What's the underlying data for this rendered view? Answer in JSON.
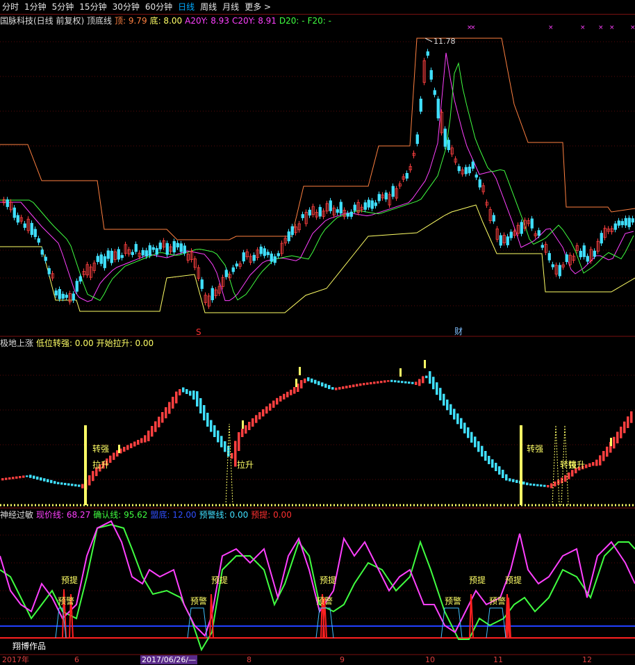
{
  "toolbar": {
    "items": [
      "分时",
      "1分钟",
      "5分钟",
      "15分钟",
      "30分钟",
      "60分钟",
      "日线",
      "周线",
      "月线",
      "更多 >"
    ],
    "active": "日线"
  },
  "panel1": {
    "title": "国脉科技(日线 前复权) 顶底线",
    "ding_label": "顶: 9.79",
    "di_label": "底: 8.00",
    "a20y_label": "A20Y: 8.93",
    "c20y_label": "C20Y: 8.91",
    "d20_label": "D20: -",
    "f20_label": "F20: -",
    "peak_label": "11.78",
    "marker_s": "S",
    "marker_cai": "财"
  },
  "panel2": {
    "title": "极地上涨",
    "zhuanqiang_label": "低位转强: 0.00",
    "kaishi_label": "开始拉升: 0.00",
    "annotations": [
      "转强",
      "拉升",
      "拉升",
      "转强",
      "转强",
      "拉升"
    ]
  },
  "panel3": {
    "title": "神经过敏",
    "xianjia_label": "现价线: 68.27",
    "queren_label": "确认线: 95.62",
    "didi_label": "盟底: 12.00",
    "yujing_label": "预警线: 0.00",
    "yuti_label": "预提: 0.00",
    "annotations": [
      "预提",
      "预警",
      "预提",
      "预警",
      "预提",
      "预警",
      "预提",
      "预警",
      "预提",
      "预警"
    ],
    "watermark": "翔博作品"
  },
  "xaxis": {
    "labels": [
      "2017年",
      "6",
      "2017/06/26/—",
      "8",
      "9",
      "10",
      "11",
      "12"
    ]
  },
  "colors": {
    "bg": "#000000",
    "up": "#ff4040",
    "down": "#40e0ff",
    "top_line": "#ff8040",
    "bottom_line": "#ffff66",
    "a20y": "#ff40ff",
    "c20y": "#40ff40",
    "grid": "#7a1010"
  }
}
